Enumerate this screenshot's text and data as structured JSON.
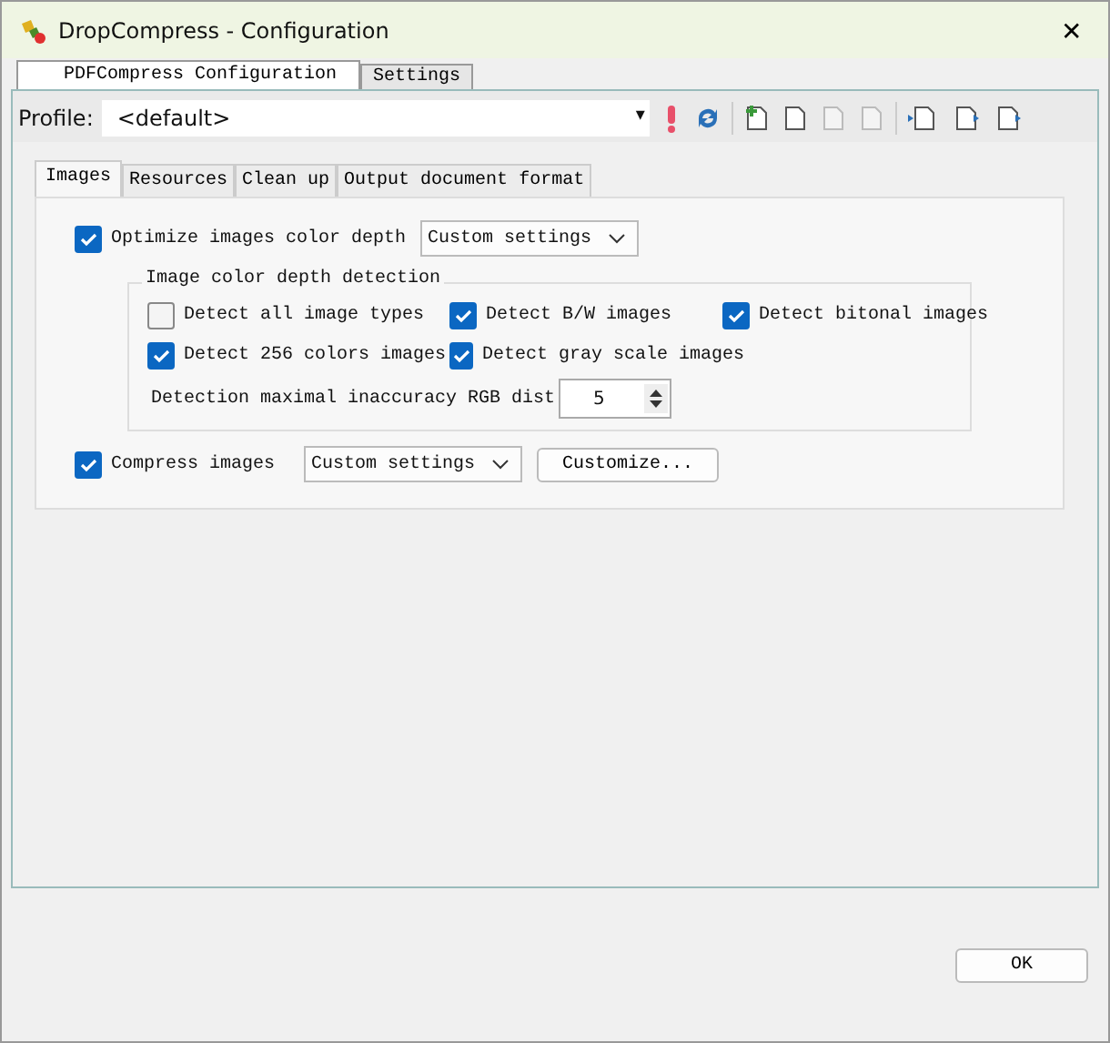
{
  "window": {
    "title": "DropCompress - Configuration",
    "close": "✕"
  },
  "tabs": [
    {
      "label": "PDFCompress Configuration",
      "selected": true
    },
    {
      "label": "Settings",
      "selected": false
    }
  ],
  "profile": {
    "label": "Profile:",
    "value": "<default>",
    "caret": "▾"
  },
  "inner_tabs": [
    {
      "label": "Images",
      "selected": true
    },
    {
      "label": "Resources",
      "selected": false
    },
    {
      "label": "Clean up",
      "selected": false
    },
    {
      "label": "Output document format",
      "selected": false
    }
  ],
  "optimize": {
    "label": "Optimize images color depth",
    "checked": true,
    "select": "Custom settings"
  },
  "detection": {
    "title": "Image color depth detection",
    "options": [
      {
        "label": "Detect all image types",
        "checked": false
      },
      {
        "label": "Detect B/W images",
        "checked": true
      },
      {
        "label": "Detect bitonal images",
        "checked": true
      },
      {
        "label": "Detect 256 colors images",
        "checked": true
      },
      {
        "label": "Detect gray scale images",
        "checked": true
      }
    ],
    "inaccuracy_label": "Detection maximal inaccuracy RGB dist",
    "inaccuracy_value": "5"
  },
  "compress": {
    "label": "Compress images",
    "checked": true,
    "select": "Custom settings",
    "button": "Customize..."
  },
  "ok": "OK"
}
